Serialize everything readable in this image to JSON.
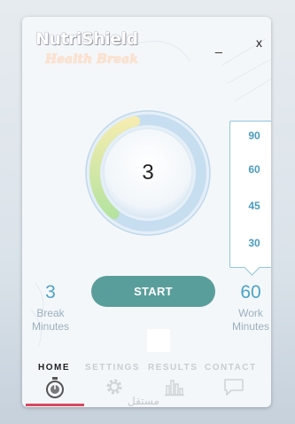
{
  "app": {
    "title": "NutriShield",
    "subtitle": "Health Break"
  },
  "window_controls": {
    "minimize": "_",
    "close": "x"
  },
  "timer": {
    "value": "3",
    "progress": 0.35
  },
  "picker": {
    "options": [
      "90",
      "60",
      "45",
      "30"
    ]
  },
  "break": {
    "value": "3",
    "label_line1": "Break",
    "label_line2": "Minutes"
  },
  "work": {
    "value": "60",
    "label_line1": "Work",
    "label_line2": "Minutes"
  },
  "start_label": "START",
  "tabs": [
    {
      "label": "HOME",
      "icon": "stopwatch-icon",
      "active": true
    },
    {
      "label": "SETTINGS",
      "icon": "gear-icon",
      "active": false
    },
    {
      "label": "RESULTS",
      "icon": "bar-chart-icon",
      "active": false
    },
    {
      "label": "CONTACT",
      "icon": "chat-bubble-icon",
      "active": false
    }
  ],
  "watermark": "مستقل",
  "colors": {
    "accent_teal": "#5a9e9b",
    "accent_blue": "#4ea3c6",
    "active_underline": "#d9485f",
    "dial_ring": "#c9dff0"
  }
}
